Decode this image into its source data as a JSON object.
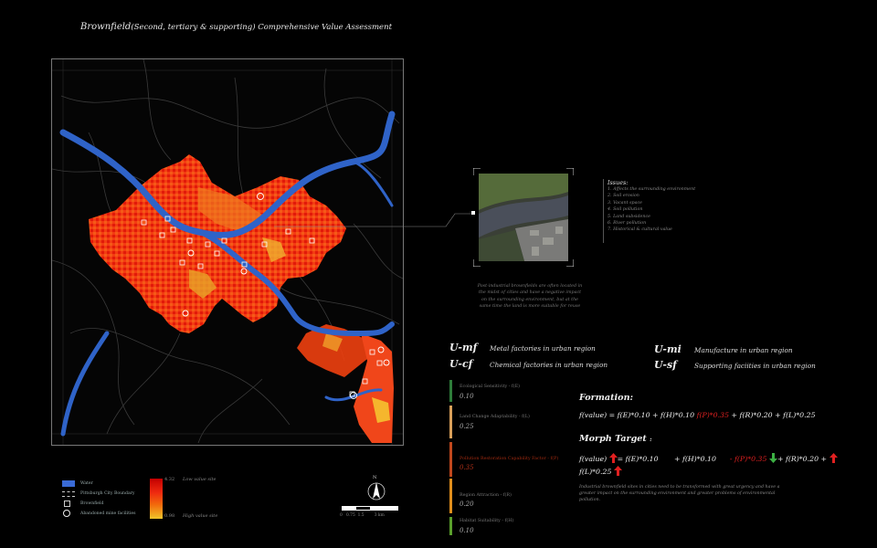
{
  "title": {
    "main": "Brownfield",
    "sub": "(Second, tertiary & supporting) Comprehensive Value Assessment"
  },
  "map": {
    "name": "brownfield-value-map"
  },
  "legend": {
    "items": [
      {
        "label": "Water",
        "color": "#3a6bd6"
      },
      {
        "label": "Pittsburgh City Boundary"
      },
      {
        "label": "Brownfield"
      },
      {
        "label": "Abandoned mine facilities"
      }
    ],
    "ramp": {
      "high_value": "4.32",
      "high_label": "Low value site",
      "low_value": "0.98",
      "low_label": "High value site"
    }
  },
  "scale": {
    "labels": [
      "0",
      "0.75",
      "1.5",
      "3 km"
    ],
    "north": "N"
  },
  "issues": {
    "title": "Issues:",
    "items": [
      "1. Affects the surrounding environment",
      "2. Soil erosion",
      "3. Vacant space",
      "4. Soil pollution",
      "5. Land subsidence",
      "6. River pollution",
      "7. Historical & cultural value"
    ]
  },
  "description": "Post-industrial brownfields are often located in the midst of cities and have a negative impact on the surrounding environment, but at the same time the land is more suitable for reuse",
  "codes": [
    {
      "code": "U-mf",
      "desc": "Metal factories in urban region"
    },
    {
      "code": "U-cf",
      "desc": "Chemical factories in urban region"
    },
    {
      "code": "U-mi",
      "desc": "Manufacture in urban region"
    },
    {
      "code": "U-sf",
      "desc": "Supporting faciities in urban region"
    }
  ],
  "factors": [
    {
      "name": "Ecological Sensitivity - f(E)",
      "value": "0.10",
      "color": "#2e7d3a"
    },
    {
      "name": "Land Change Adaptability - f(L)",
      "value": "0.25",
      "color": "#d9a05a"
    },
    {
      "name": "Pollution Restoration Capability Factor - f(P)",
      "value": "0.35",
      "color": "#c0481d"
    },
    {
      "name": "Region Attraction - f(R)",
      "value": "0.20",
      "color": "#e08e1c"
    },
    {
      "name": "Habitat Suitability - f(H)",
      "value": "0.10",
      "color": "#5aa02c"
    }
  ],
  "formation": {
    "title": "Formation:",
    "part1": "f(value) = f(E)*0.10 + f(H)*0.10 ",
    "part2": "f(P)*0.35",
    "part3": " + f(R)*0.20 + f(L)*0.25"
  },
  "morph": {
    "title": "Morph Target",
    "colon": ":",
    "p1": "f(value)",
    "p2": "= f(E)*0.10",
    "p3": "+ f(H)*0.10",
    "p4": "- f(P)*0.35",
    "p5": "+ f(R)*0.20 +",
    "p6": "f(L)*0.25",
    "up_color": "#e02020",
    "down_color": "#3cb043"
  },
  "note": "Industrial brownfield sites in cities need to be transformed with great urgency and have a greater impact on the surrounding environment and greater problems of environmental pollution."
}
